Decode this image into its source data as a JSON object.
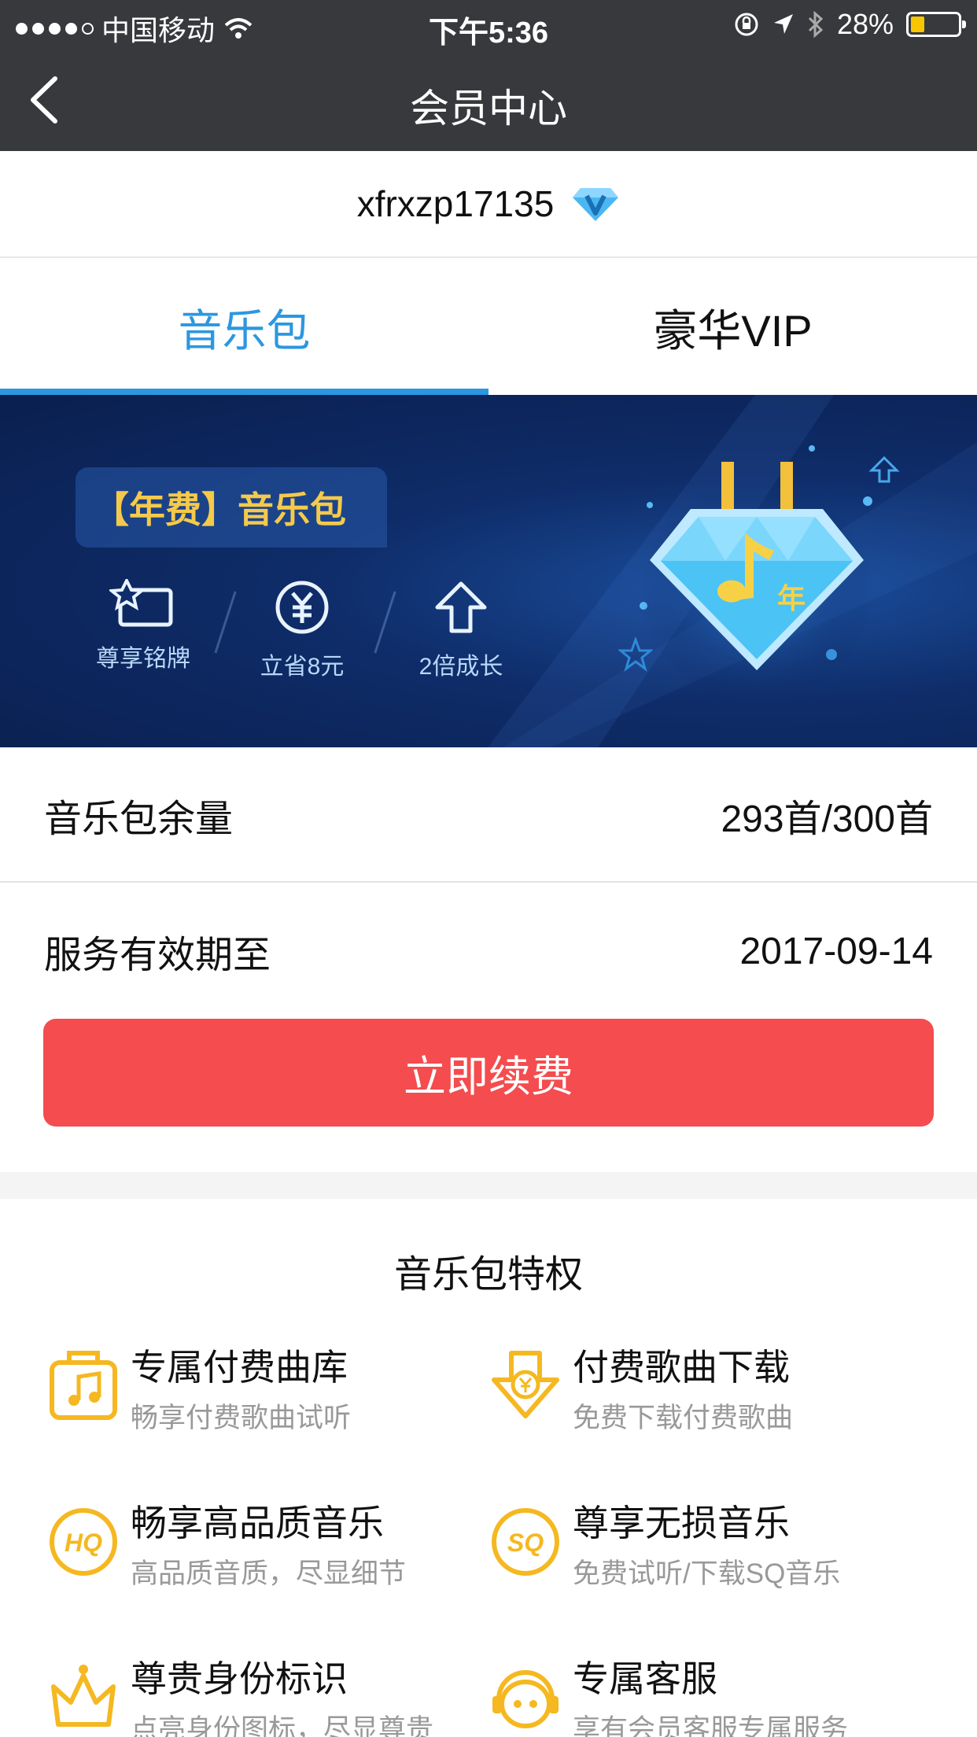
{
  "status": {
    "carrier": "中国移动",
    "time": "下午5:36",
    "battery": "28%",
    "battery_level": 0.28
  },
  "nav": {
    "title": "会员中心"
  },
  "user": {
    "name": "xfrxzp17135"
  },
  "tabs": [
    {
      "label": "音乐包",
      "active": true
    },
    {
      "label": "豪华VIP",
      "active": false
    }
  ],
  "banner": {
    "tag": "【年费】音乐包",
    "features": [
      "尊享铭牌",
      "立省8元",
      "2倍成长"
    ],
    "badge_char": "年"
  },
  "info": {
    "remaining_label": "音乐包余量",
    "remaining_value": "293首/300首",
    "expiry_label": "服务有效期至",
    "expiry_value": "2017-09-14"
  },
  "renew_label": "立即续费",
  "privileges": {
    "title": "音乐包特权",
    "items": [
      {
        "title": "专属付费曲库",
        "desc": "畅享付费歌曲试听",
        "icon": "music-library-icon"
      },
      {
        "title": "付费歌曲下载",
        "desc": "免费下载付费歌曲",
        "icon": "download-yuan-icon"
      },
      {
        "title": "畅享高品质音乐",
        "desc": "高品质音质，尽显细节",
        "icon": "hq-icon",
        "icon_text": "HQ"
      },
      {
        "title": "尊享无损音乐",
        "desc": "免费试听/下载SQ音乐",
        "icon": "sq-icon",
        "icon_text": "SQ"
      },
      {
        "title": "尊贵身份标识",
        "desc": "点亮身份图标，尽显尊贵",
        "icon": "crown-icon"
      },
      {
        "title": "专属客服",
        "desc": "享有会员客服专属服务",
        "icon": "customer-service-icon"
      }
    ]
  },
  "colors": {
    "accent": "#2c97e0",
    "renew": "#f44c4f",
    "icon_yellow": "#f5b820",
    "topbar": "#37393c"
  }
}
